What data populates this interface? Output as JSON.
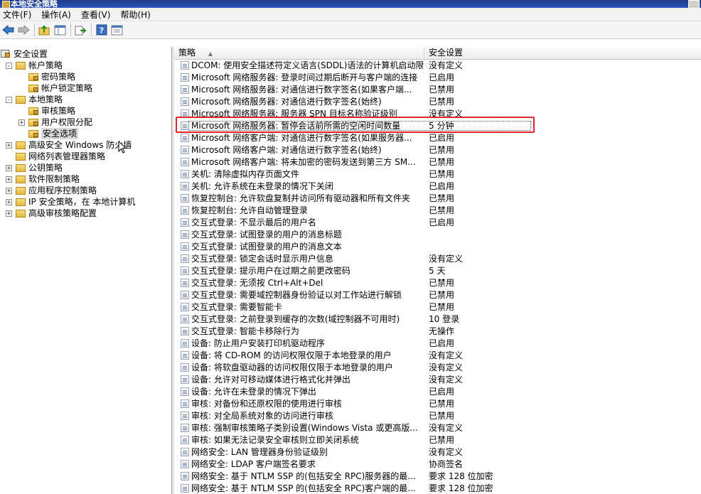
{
  "window": {
    "title": "本地安全策略"
  },
  "menu": [
    "文件(F)",
    "操作(A)",
    "查看(V)",
    "帮助(H)"
  ],
  "toolbar": [
    "back-icon",
    "forward-icon",
    "up-folder-icon",
    "show-tree-icon",
    "export-list-icon",
    "help-icon",
    "properties-icon"
  ],
  "tree": [
    {
      "label": "安全设置",
      "level": 0,
      "exp": ""
    },
    {
      "label": "帐户策略",
      "level": 1,
      "exp": "-"
    },
    {
      "label": "密码策略",
      "level": 2,
      "exp": ""
    },
    {
      "label": "帐户锁定策略",
      "level": 2,
      "exp": ""
    },
    {
      "label": "本地策略",
      "level": 1,
      "exp": "-"
    },
    {
      "label": "审核策略",
      "level": 2,
      "exp": ""
    },
    {
      "label": "用户权限分配",
      "level": 2,
      "exp": "+"
    },
    {
      "label": "安全选项",
      "level": 2,
      "exp": "",
      "selected": true
    },
    {
      "label": "高级安全 Windows 防火墙",
      "level": 1,
      "exp": "+"
    },
    {
      "label": "网络列表管理器策略",
      "level": 1,
      "exp": ""
    },
    {
      "label": "公钥策略",
      "level": 1,
      "exp": "+"
    },
    {
      "label": "软件限制策略",
      "level": 1,
      "exp": "+"
    },
    {
      "label": "应用程序控制策略",
      "level": 1,
      "exp": "+"
    },
    {
      "label": "IP 安全策略，在 本地计算机",
      "level": 1,
      "exp": "+"
    },
    {
      "label": "高级审核策略配置",
      "level": 1,
      "exp": "+"
    }
  ],
  "columns": {
    "policy": "策略",
    "setting": "安全设置"
  },
  "rows": [
    [
      "DCOM: 使用安全描述符定义语言(SDDL)语法的计算机启动限制",
      "没有定义"
    ],
    [
      "Microsoft 网络服务器: 登录时间过期后断开与客户端的连接",
      "已启用"
    ],
    [
      "Microsoft 网络服务器: 对通信进行数字签名(如果客户端...",
      "已禁用"
    ],
    [
      "Microsoft 网络服务器: 对通信进行数字签名(始终)",
      "已禁用"
    ],
    [
      "Microsoft 网络服务器: 服务器 SPN 目标名称验证级别",
      "没有定义"
    ],
    [
      "Microsoft 网络服务器: 暂停会话前所需的空闲时间数量",
      "5 分钟"
    ],
    [
      "Microsoft 网络客户端: 对通信进行数字签名(如果服务器...",
      "已启用"
    ],
    [
      "Microsoft 网络客户端: 对通信进行数字签名(始终)",
      "已禁用"
    ],
    [
      "Microsoft 网络客户端: 将未加密的密码发送到第三方 SM...",
      "已禁用"
    ],
    [
      "关机: 清除虚拟内存页面文件",
      "已禁用"
    ],
    [
      "关机: 允许系统在未登录的情况下关闭",
      "已启用"
    ],
    [
      "恢复控制台: 允许软盘复制并访问所有驱动器和所有文件夹",
      "已禁用"
    ],
    [
      "恢复控制台: 允许自动管理登录",
      "已禁用"
    ],
    [
      "交互式登录: 不显示最后的用户名",
      "已启用"
    ],
    [
      "交互式登录: 试图登录的用户的消息标题",
      ""
    ],
    [
      "交互式登录: 试图登录的用户的消息文本",
      ""
    ],
    [
      "交互式登录: 锁定会话时显示用户信息",
      "没有定义"
    ],
    [
      "交互式登录: 提示用户在过期之前更改密码",
      "5 天"
    ],
    [
      "交互式登录: 无须按 Ctrl+Alt+Del",
      "已禁用"
    ],
    [
      "交互式登录: 需要域控制器身份验证以对工作站进行解锁",
      "已禁用"
    ],
    [
      "交互式登录: 需要智能卡",
      "已禁用"
    ],
    [
      "交互式登录: 之前登录到缓存的次数(域控制器不可用时)",
      "10 登录"
    ],
    [
      "交互式登录: 智能卡移除行为",
      "无操作"
    ],
    [
      "设备: 防止用户安装打印机驱动程序",
      "已启用"
    ],
    [
      "设备: 将 CD-ROM 的访问权限仅限于本地登录的用户",
      "没有定义"
    ],
    [
      "设备: 将软盘驱动器的访问权限仅限于本地登录的用户",
      "没有定义"
    ],
    [
      "设备: 允许对可移动媒体进行格式化并弹出",
      "没有定义"
    ],
    [
      "设备: 允许在未登录的情况下弹出",
      "已启用"
    ],
    [
      "审核: 对备份和还原权限的使用进行审核",
      "已禁用"
    ],
    [
      "审核: 对全局系统对象的访问进行审核",
      "已禁用"
    ],
    [
      "审核: 强制审核策略子类别设置(Windows Vista 或更高版...",
      "没有定义"
    ],
    [
      "审核: 如果无法记录安全审核则立即关闭系统",
      "已禁用"
    ],
    [
      "网络安全: LAN 管理器身份验证级别",
      "没有定义"
    ],
    [
      "网络安全: LDAP 客户端签名要求",
      "协商签名"
    ],
    [
      "网络安全: 基于 NTLM SSP 的(包括安全 RPC)服务器的最...",
      "要求 128 位加密"
    ],
    [
      "网络安全: 基于 NTLM SSP 的(包括安全 RPC)客户端的最...",
      "要求 128 位加密"
    ]
  ],
  "highlight_row": 5,
  "colors": {
    "highlight_box": "#e0252a",
    "selection": "#d9d9d9"
  }
}
